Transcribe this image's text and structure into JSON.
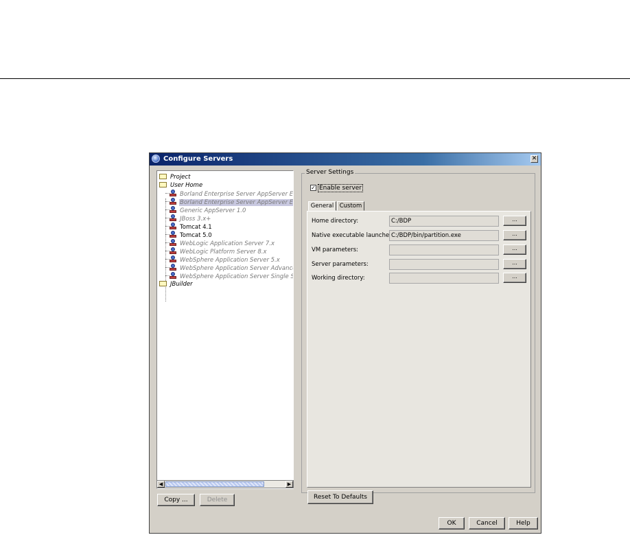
{
  "dialog": {
    "title": "Configure Servers",
    "close_glyph": "✕"
  },
  "tree": {
    "items": [
      {
        "label": "Project",
        "icon": "folder-icon",
        "style": "folder"
      },
      {
        "label": "User Home",
        "icon": "folder-icon",
        "style": "folder"
      },
      {
        "label": "Borland Enterprise Server AppServer Edition",
        "icon": "server-icon",
        "style": "italic"
      },
      {
        "label": "Borland Enterprise Server AppServer Edition",
        "icon": "server-icon",
        "style": "italic-selected"
      },
      {
        "label": "Generic AppServer 1.0",
        "icon": "server-icon",
        "style": "italic"
      },
      {
        "label": "JBoss 3.x+",
        "icon": "server-icon",
        "style": "italic"
      },
      {
        "label": "Tomcat 4.1",
        "icon": "server-icon",
        "style": "normal"
      },
      {
        "label": "Tomcat 5.0",
        "icon": "server-icon",
        "style": "normal"
      },
      {
        "label": "WebLogic Application Server 7.x",
        "icon": "server-icon",
        "style": "italic"
      },
      {
        "label": "WebLogic Platform Server 8.x",
        "icon": "server-icon",
        "style": "italic"
      },
      {
        "label": "WebSphere Application Server 5.x",
        "icon": "server-icon",
        "style": "italic"
      },
      {
        "label": "WebSphere Application Server Advanced Edition",
        "icon": "server-icon",
        "style": "italic"
      },
      {
        "label": "WebSphere Application Server Single Server",
        "icon": "server-icon",
        "style": "italic"
      },
      {
        "label": "JBuilder",
        "icon": "folder-icon",
        "style": "folder"
      }
    ]
  },
  "left_buttons": {
    "copy": "Copy ...",
    "delete": "Delete"
  },
  "settings": {
    "group_label": "Server Settings",
    "enable_label": "Enable server",
    "enable_checked": true,
    "check_glyph": "✓",
    "tabs": [
      {
        "label": "General",
        "active": true
      },
      {
        "label": "Custom",
        "active": false
      }
    ],
    "fields": [
      {
        "label": "Home directory:",
        "value": "C:/BDP",
        "browse": "..."
      },
      {
        "label": "Native executable launcher:",
        "value": "C:/BDP/bin/partition.exe",
        "browse": "..."
      },
      {
        "label": "VM parameters:",
        "value": "",
        "browse": "..."
      },
      {
        "label": "Server parameters:",
        "value": "",
        "browse": "..."
      },
      {
        "label": "Working directory:",
        "value": "",
        "browse": "..."
      }
    ],
    "reset_label": "Reset To Defaults"
  },
  "footer": {
    "ok": "OK",
    "cancel": "Cancel",
    "help": "Help"
  },
  "scrollbar": {
    "left_arrow": "◀",
    "right_arrow": "▶"
  }
}
